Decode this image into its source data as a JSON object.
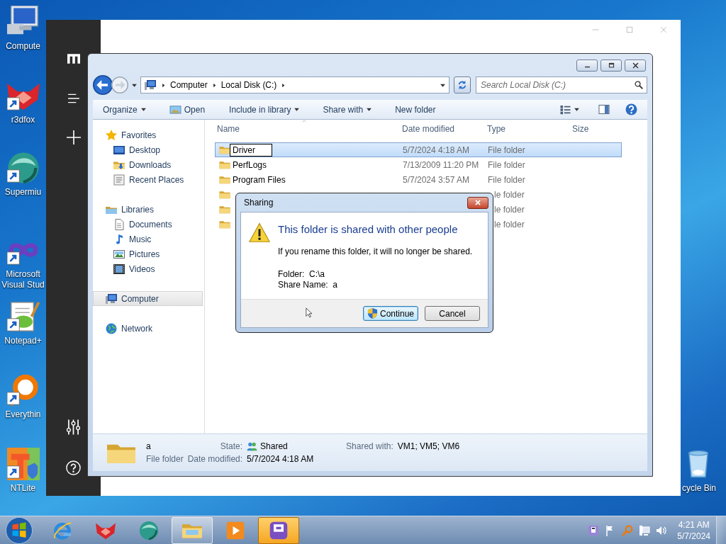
{
  "desktop_icons": [
    {
      "kind": "computer",
      "label": "Compute"
    },
    {
      "kind": "fox",
      "label": "r3dfox"
    },
    {
      "kind": "globe",
      "label": "Supermiu"
    },
    {
      "kind": "infinity",
      "label": "Microsoft Visual Stud"
    },
    {
      "kind": "notepad",
      "label": "Notepad+"
    },
    {
      "kind": "magnifier",
      "label": "Everythin"
    },
    {
      "kind": "ntlite",
      "label": "NTLite"
    }
  ],
  "recycle_bin": {
    "label": "cycle Bin"
  },
  "explorer": {
    "address": [
      "Computer",
      "Local Disk (C:)"
    ],
    "search": {
      "placeholder": "Search Local Disk (C:)"
    },
    "toolbar": [
      {
        "kind": "menu",
        "label": "Organize"
      },
      {
        "kind": "open",
        "label": "Open"
      },
      {
        "kind": "menu",
        "label": "Include in library"
      },
      {
        "kind": "menu",
        "label": "Share with"
      },
      {
        "kind": "plain",
        "label": "New folder"
      }
    ],
    "nav": [
      {
        "kind": "star",
        "label": "Favorites",
        "selected": false,
        "children": [
          {
            "kind": "desktop",
            "label": "Desktop",
            "selected": false
          },
          {
            "kind": "downloads",
            "label": "Downloads",
            "selected": false
          },
          {
            "kind": "recent",
            "label": "Recent Places",
            "selected": false
          }
        ]
      },
      {
        "kind": "library",
        "label": "Libraries",
        "selected": false,
        "children": [
          {
            "kind": "document",
            "label": "Documents",
            "selected": false
          },
          {
            "kind": "music",
            "label": "Music",
            "selected": false
          },
          {
            "kind": "picture",
            "label": "Pictures",
            "selected": false
          },
          {
            "kind": "video",
            "label": "Videos",
            "selected": false
          }
        ]
      },
      {
        "kind": "computer",
        "label": "Computer",
        "selected": true
      },
      {
        "kind": "network",
        "label": "Network",
        "selected": false
      }
    ],
    "columns": [
      "Name",
      "Date modified",
      "Type",
      "Size"
    ],
    "rows": [
      {
        "name": "Driver",
        "date": "5/7/2024 4:18 AM",
        "type": "File folder",
        "selected": true,
        "editing": true
      },
      {
        "name": "PerfLogs",
        "date": "7/13/2009 11:20 PM",
        "type": "File folder",
        "selected": false,
        "editing": false
      },
      {
        "name": "Program Files",
        "date": "5/7/2024 3:57 AM",
        "type": "File folder",
        "selected": false,
        "editing": false
      },
      {
        "type": "le folder",
        "selected": false
      },
      {
        "type": "le folder",
        "selected": false
      },
      {
        "type": "le folder",
        "selected": false
      }
    ],
    "details": {
      "name": "a",
      "type": "File folder",
      "fields": [
        {
          "kind": "shared",
          "label": "State:",
          "value": "Shared"
        },
        {
          "kind": "plain",
          "label": "Date modified:",
          "value": "5/7/2024 4:18 AM"
        },
        {
          "kind": "plain",
          "label": "Shared with:",
          "value": "VM1; VM5; VM6"
        }
      ]
    }
  },
  "dialog": {
    "title": "Sharing",
    "heading": "This folder is shared with other people",
    "message": "If you rename this folder, it will no longer be shared.",
    "details": [
      "Folder:  C:\\a",
      "Share Name:  a"
    ],
    "buttons": [
      {
        "label": "Continue",
        "default": true,
        "shield": true
      },
      {
        "label": "Cancel",
        "default": false,
        "shield": false
      }
    ]
  },
  "taskbar": {
    "apps": [
      {
        "kind": "ie",
        "running": false,
        "flashing": false
      },
      {
        "kind": "fox",
        "running": false,
        "flashing": false
      },
      {
        "kind": "globe",
        "running": false,
        "flashing": false
      },
      {
        "kind": "explorer",
        "running": true,
        "flashing": false
      },
      {
        "kind": "media",
        "running": false,
        "flashing": false
      },
      {
        "kind": "app",
        "running": false,
        "flashing": true
      }
    ],
    "clock": {
      "time": "4:21 AM",
      "date": "5/7/2024"
    }
  }
}
